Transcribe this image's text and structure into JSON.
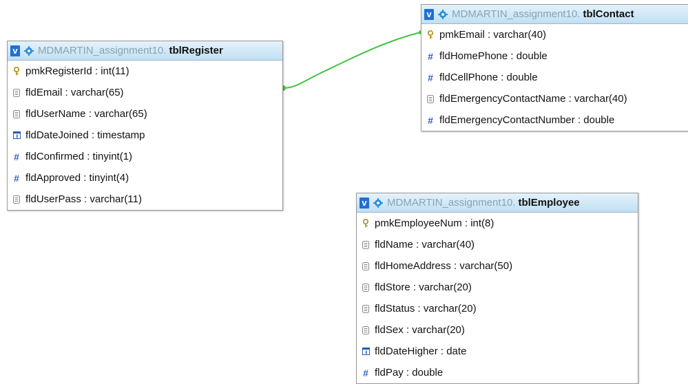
{
  "tables": {
    "register": {
      "db": "MDMARTIN_assignment10.",
      "name": "tblRegister",
      "fields": [
        {
          "label": "pmkRegisterId : int(11)",
          "icon": "primary-key-icon"
        },
        {
          "label": "fldEmail : varchar(65)",
          "icon": "text-field-icon"
        },
        {
          "label": "fldUserName : varchar(65)",
          "icon": "text-field-icon"
        },
        {
          "label": "fldDateJoined : timestamp",
          "icon": "date-field-icon"
        },
        {
          "label": "fldConfirmed : tinyint(1)",
          "icon": "numeric-field-icon"
        },
        {
          "label": "fldApproved : tinyint(4)",
          "icon": "numeric-field-icon"
        },
        {
          "label": "fldUserPass : varchar(11)",
          "icon": "text-field-icon"
        }
      ]
    },
    "contact": {
      "db": "MDMARTIN_assignment10.",
      "name": "tblContact",
      "fields": [
        {
          "label": "pmkEmail : varchar(40)",
          "icon": "primary-key-icon"
        },
        {
          "label": "fldHomePhone : double",
          "icon": "numeric-field-icon"
        },
        {
          "label": "fldCellPhone : double",
          "icon": "numeric-field-icon"
        },
        {
          "label": "fldEmergencyContactName : varchar(40)",
          "icon": "text-field-icon"
        },
        {
          "label": "fldEmergencyContactNumber : double",
          "icon": "numeric-field-icon"
        }
      ]
    },
    "employee": {
      "db": "MDMARTIN_assignment10.",
      "name": "tblEmployee",
      "fields": [
        {
          "label": "pmkEmployeeNum : int(8)",
          "icon": "primary-key-icon"
        },
        {
          "label": "fldName : varchar(40)",
          "icon": "text-field-icon"
        },
        {
          "label": "fldHomeAddress : varchar(50)",
          "icon": "text-field-icon"
        },
        {
          "label": "fldStore : varchar(20)",
          "icon": "text-field-icon"
        },
        {
          "label": "fldStatus : varchar(20)",
          "icon": "text-field-icon"
        },
        {
          "label": "fldSex : varchar(20)",
          "icon": "text-field-icon"
        },
        {
          "label": "fldDateHigher : date",
          "icon": "date-field-icon"
        },
        {
          "label": "fldPay : double",
          "icon": "numeric-field-icon"
        }
      ]
    }
  },
  "ui": {
    "toggle_glyph": "v",
    "numeric_glyph": "#",
    "relation_color": "#3ec43e",
    "header_db_color": "#8aa2b4",
    "toggle_color": "#1f6fd6"
  }
}
